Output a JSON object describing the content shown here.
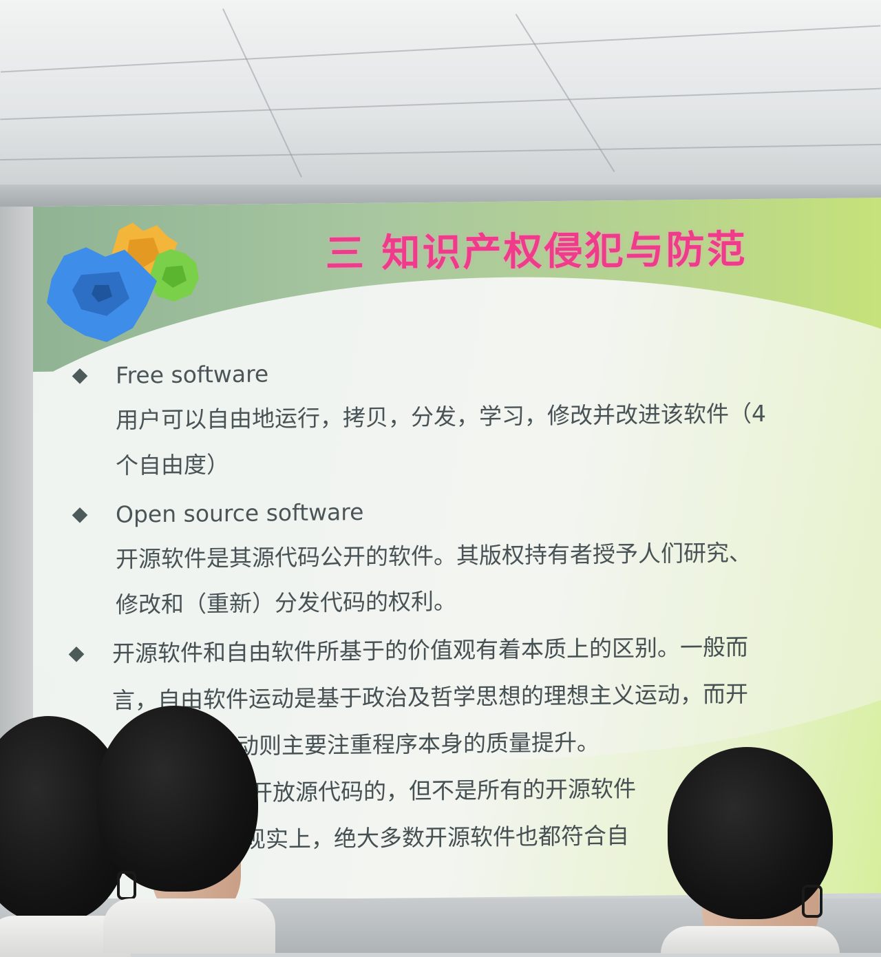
{
  "slide": {
    "title": "三 知识产权侵犯与防范",
    "bullets": [
      {
        "heading": "Free software",
        "lines": [
          "用户可以自由地运行，拷贝，分发，学习，修改并改进该软件（4",
          "个自由度）"
        ]
      },
      {
        "heading": "Open source software",
        "lines": [
          "开源软件是其源代码公开的软件。其版权持有者授予人们研究、",
          "修改和（重新）分发代码的权利。"
        ]
      },
      {
        "heading": "",
        "lines": [
          "开源软件和自由软件所基于的价值观有着本质上的区别。一般而",
          "言，自由软件运动是基于政治及哲学思想的理想主义运动，而开",
          "动则主要注重程序本身的质量提升。",
          "开放源代码的，但不是所有的开源软件",
          "现实上，绝大多数开源软件也都符合自"
        ]
      }
    ]
  },
  "colors": {
    "title": "#ee3c8a",
    "header_green": "#a8c7a0",
    "body_text": "#495356",
    "gear_blue": "#3e8de8",
    "gear_orange": "#f3b53a",
    "gear_green": "#7bd04a"
  }
}
